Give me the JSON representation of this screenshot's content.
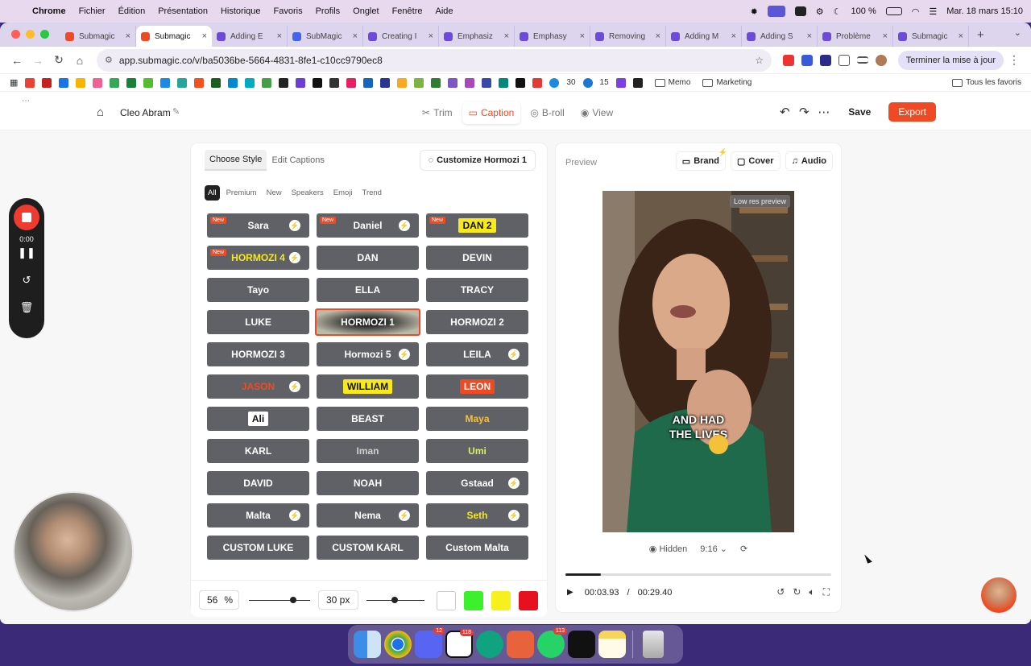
{
  "menubar": {
    "app": "Chrome",
    "items": [
      "Fichier",
      "Édition",
      "Présentation",
      "Historique",
      "Favoris",
      "Profils",
      "Onglet",
      "Fenêtre",
      "Aide"
    ],
    "battery": "100 %",
    "datetime": "Mar. 18 mars  15:10"
  },
  "tabs": [
    {
      "title": "Submagic",
      "color": "#ef4a23"
    },
    {
      "title": "Submagic",
      "color": "#ef4a23",
      "active": true
    },
    {
      "title": "Adding E",
      "color": "#6c4bd8"
    },
    {
      "title": "SubMagic",
      "color": "#4263eb"
    },
    {
      "title": "Creating I",
      "color": "#6c4bd8"
    },
    {
      "title": "Emphasiz",
      "color": "#6c4bd8"
    },
    {
      "title": "Emphasy",
      "color": "#6c4bd8"
    },
    {
      "title": "Removing",
      "color": "#6c4bd8"
    },
    {
      "title": "Adding M",
      "color": "#6c4bd8"
    },
    {
      "title": "Adding S",
      "color": "#6c4bd8"
    },
    {
      "title": "Problème",
      "color": "#6c4bd8"
    },
    {
      "title": "Submagic",
      "color": "#6c4bd8"
    }
  ],
  "url": "app.submagic.co/v/ba5036be-5664-4831-8fe1-c10cc9790ec8",
  "update_button": "Terminer la mise à jour",
  "bookmarks": {
    "numbered": [
      "30",
      "15"
    ],
    "folders": [
      "Memo",
      "Marketing"
    ],
    "all": "Tous les favoris"
  },
  "editor": {
    "project": "Cleo Abram",
    "modes": [
      "Trim",
      "Caption",
      "B-roll",
      "View"
    ],
    "active_mode": "Caption",
    "save": "Save",
    "export": "Export",
    "accent": "#ef4a23"
  },
  "style_panel": {
    "tabs": [
      "Choose Style",
      "Edit Captions"
    ],
    "customize": "Customize Hormozi 1",
    "filters": [
      "All",
      "Premium",
      "New",
      "Speakers",
      "Emoji",
      "Trend"
    ],
    "new_badge": "New",
    "styles": [
      {
        "label": "Sara",
        "new": true,
        "bolt": true
      },
      {
        "label": "Daniel",
        "new": true,
        "bolt": true
      },
      {
        "label": "DAN 2",
        "new": true,
        "bolt": false
      },
      {
        "label": "HORMOZI 4",
        "new": true,
        "bolt": true
      },
      {
        "label": "DAN",
        "new": false,
        "bolt": false
      },
      {
        "label": "DEVIN",
        "new": false,
        "bolt": false
      },
      {
        "label": "Tayo",
        "new": false,
        "bolt": false
      },
      {
        "label": "ELLA",
        "new": false,
        "bolt": false
      },
      {
        "label": "TRACY",
        "new": false,
        "bolt": false
      },
      {
        "label": "LUKE",
        "new": false,
        "bolt": false
      },
      {
        "label": "HORMOZI 1",
        "new": false,
        "bolt": false,
        "selected": true
      },
      {
        "label": "HORMOZI 2",
        "new": false,
        "bolt": false
      },
      {
        "label": "HORMOZI 3",
        "new": false,
        "bolt": false
      },
      {
        "label": "Hormozi 5",
        "new": false,
        "bolt": true
      },
      {
        "label": "LEILA",
        "new": false,
        "bolt": true
      },
      {
        "label": "JASON",
        "new": false,
        "bolt": true
      },
      {
        "label": "WILLIAM",
        "new": false,
        "bolt": false
      },
      {
        "label": "LEON",
        "new": false,
        "bolt": false
      },
      {
        "label": "Ali",
        "new": false,
        "bolt": false
      },
      {
        "label": "BEAST",
        "new": false,
        "bolt": false
      },
      {
        "label": "Maya",
        "new": false,
        "bolt": false
      },
      {
        "label": "KARL",
        "new": false,
        "bolt": false
      },
      {
        "label": "Iman",
        "new": false,
        "bolt": false
      },
      {
        "label": "Umi",
        "new": false,
        "bolt": false
      },
      {
        "label": "DAVID",
        "new": false,
        "bolt": false
      },
      {
        "label": "NOAH",
        "new": false,
        "bolt": false
      },
      {
        "label": "Gstaad",
        "new": false,
        "bolt": true
      },
      {
        "label": "Malta",
        "new": false,
        "bolt": true
      },
      {
        "label": "Nema",
        "new": false,
        "bolt": true
      },
      {
        "label": "Seth",
        "new": false,
        "bolt": true
      },
      {
        "label": "CUSTOM LUKE",
        "new": false,
        "bolt": false
      },
      {
        "label": "CUSTOM KARL",
        "new": false,
        "bolt": false
      },
      {
        "label": "Custom Malta",
        "new": false,
        "bolt": false
      }
    ],
    "size_value": "56",
    "size_unit": "%",
    "size_level": 0.72,
    "stroke_value": "30 px",
    "stroke_level": 0.48,
    "colors": [
      "#ffffff",
      "#3cf02c",
      "#f8ef1f",
      "#e8101f"
    ]
  },
  "preview": {
    "title": "Preview",
    "tabs": [
      "Brand",
      "Cover",
      "Audio"
    ],
    "low_res": "Low res preview",
    "caption_line1": "AND HAD",
    "caption_line2": "THE LIVES",
    "hidden": "Hidden",
    "ratio": "9:16",
    "current_time": "00:03.93",
    "separator": "/",
    "total_time": "00:29.40",
    "progress": 0.134
  },
  "recorder": {
    "time": "0:00"
  },
  "dock": {
    "badges": [
      "12",
      "118",
      "113"
    ]
  }
}
